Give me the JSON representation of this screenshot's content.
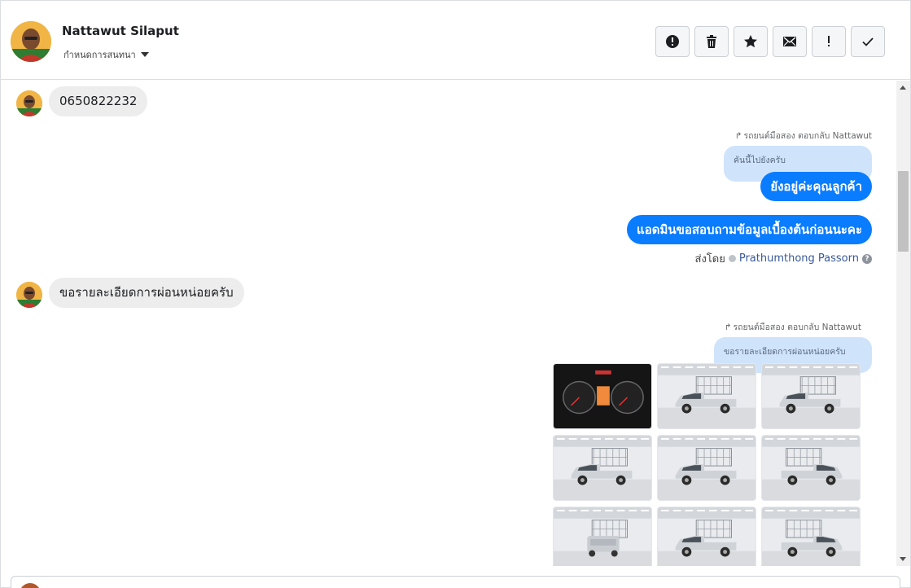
{
  "header": {
    "contact_name": "Nattawut Silaput",
    "subtitle": "กำหนดการสนทนา",
    "toolbar": [
      {
        "icon": "alert-circle-icon",
        "name": "spam-button"
      },
      {
        "icon": "trash-icon",
        "name": "delete-button"
      },
      {
        "icon": "star-icon",
        "name": "star-button"
      },
      {
        "icon": "mail-icon",
        "name": "mark-unread-button"
      },
      {
        "icon": "exclamation-icon",
        "name": "follow-up-button"
      },
      {
        "icon": "check-icon",
        "name": "mark-done-button"
      }
    ]
  },
  "messages": {
    "m1_text": "0650822232",
    "reply1_note": "รถยนต์มือสอง ตอบกลับ Nattawut",
    "reply1_quote": "คันนี้ไปยังครับ",
    "reply1_text": "ยังอยู่ค่ะคุณลูกค้า",
    "out2_text": "แอดมินขอสอบถามข้อมูลเบื้องต้นก่อนนะคะ",
    "sent_by_label": "ส่งโดย",
    "sent_by_name": "Prathumthong Passorn",
    "m2_text": "ขอรายละเอียดการผ่อนหน่อยครับ",
    "reply2_note": "รถยนต์มือสอง ตอบกลับ Nattawut",
    "reply2_quote": "ขอรายละเอียดการผ่อนหน่อยครับ"
  },
  "gallery": [
    {
      "kind": "dashboard"
    },
    {
      "kind": "truck-front"
    },
    {
      "kind": "truck-front-left"
    },
    {
      "kind": "truck-side-left"
    },
    {
      "kind": "truck-rear-left"
    },
    {
      "kind": "truck-side-right"
    },
    {
      "kind": "truck-rear"
    },
    {
      "kind": "truck-side-left-2"
    },
    {
      "kind": "truck-front-right"
    }
  ],
  "colors": {
    "outgoing_bubble": "#0a7cff",
    "incoming_bubble": "#ededed",
    "quote_bubble": "#cfe3fb"
  }
}
